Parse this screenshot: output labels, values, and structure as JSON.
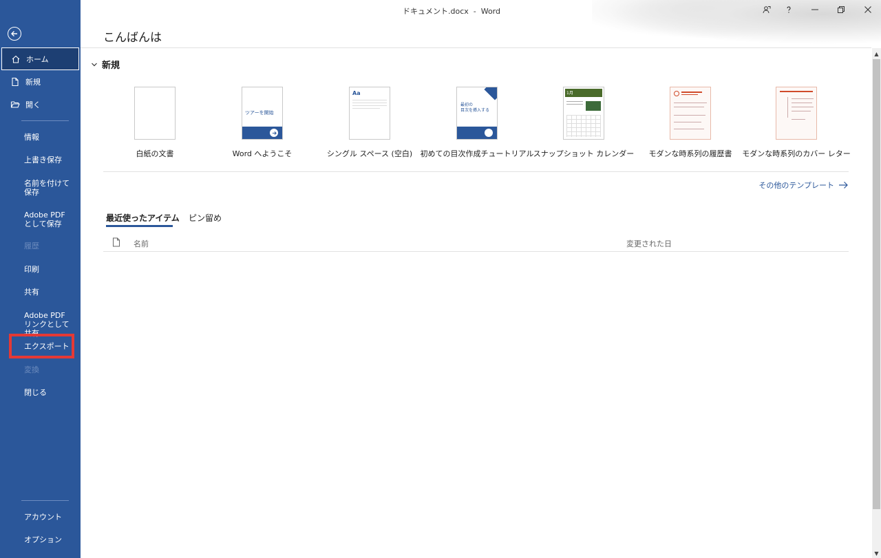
{
  "window": {
    "title": "ドキュメント.docx  -  Word"
  },
  "sidebar": {
    "back_icon": "back-arrow-circle-icon",
    "items_top": [
      {
        "label": "ホーム",
        "icon": "home-icon",
        "active": true
      },
      {
        "label": "新規",
        "icon": "new-document-icon"
      },
      {
        "label": "開く",
        "icon": "folder-open-icon"
      }
    ],
    "items_mid": [
      {
        "label": "情報"
      },
      {
        "label": "上書き保存"
      },
      {
        "label": "名前を付けて保存"
      },
      {
        "label": "Adobe PDF として保存"
      },
      {
        "label": "履歴",
        "disabled": true
      },
      {
        "label": "印刷"
      },
      {
        "label": "共有"
      },
      {
        "label": "Adobe PDF リンクとして共有"
      },
      {
        "label": "エクスポート",
        "highlighted": true
      },
      {
        "label": "変換",
        "disabled": true
      },
      {
        "label": "閉じる"
      }
    ],
    "items_bottom": [
      {
        "label": "アカウント"
      },
      {
        "label": "オプション"
      }
    ],
    "colors": {
      "background": "#2b579a",
      "highlight": "#e53935"
    }
  },
  "header": {
    "greeting": "こんばんは"
  },
  "new_section": {
    "title": "新規",
    "templates": [
      {
        "label": "白紙の文書"
      },
      {
        "label": "Word へようこそ",
        "thumb_text": "ツアーを開始"
      },
      {
        "label": "シングル スペース (空白)",
        "thumb_text": "Aa"
      },
      {
        "label": "初めての目次作成チュートリアル",
        "thumb_text": "最初の\n目次を挿入する"
      },
      {
        "label": "スナップショット カレンダー",
        "thumb_text": "1月"
      },
      {
        "label": "モダンな時系列の履歴書"
      },
      {
        "label": "モダンな時系列のカバー レター"
      }
    ],
    "more_templates": "その他のテンプレート"
  },
  "recent": {
    "tabs": [
      {
        "label": "最近使ったアイテム",
        "active": true
      },
      {
        "label": "ピン留め"
      }
    ],
    "columns": {
      "name": "名前",
      "modified": "変更された日"
    }
  }
}
